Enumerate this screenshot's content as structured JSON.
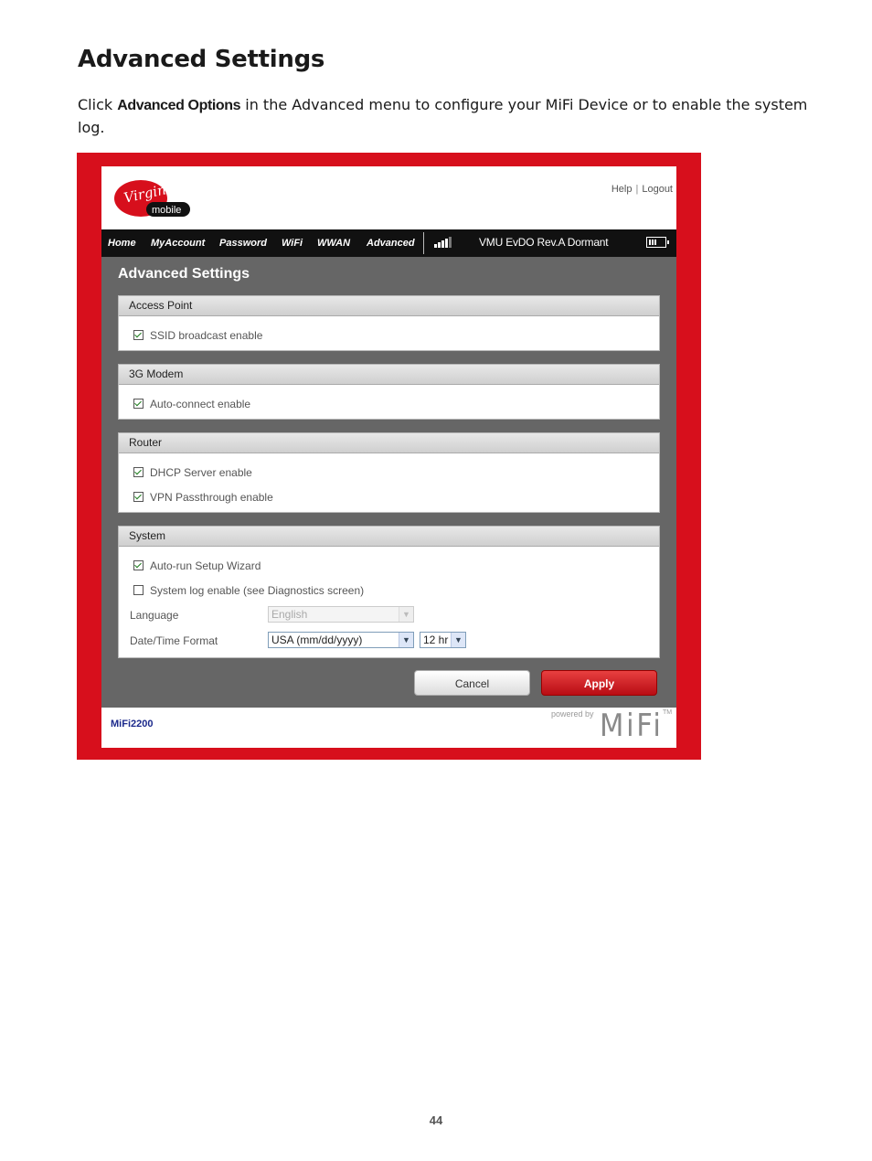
{
  "document": {
    "title": "Advanced Settings",
    "intro_prefix": "Click ",
    "intro_bold": "Advanced Options",
    "intro_suffix": " in the Advanced menu to configure your MiFi Device or to enable the system log.",
    "page_number": "44"
  },
  "ui": {
    "brand_colors": {
      "frame": "#d70f1c",
      "nav_bg": "#111111",
      "content_bg": "#666666",
      "model_text": "#1c2a8c"
    },
    "header": {
      "logo_text_top": "Virgin",
      "logo_text_bottom": "mobile",
      "help": "Help",
      "separator": "|",
      "logout": "Logout"
    },
    "nav": {
      "items": [
        "Home",
        "MyAccount",
        "Password",
        "WiFi",
        "WWAN",
        "Advanced"
      ],
      "signal_icon": "signal-bars-icon",
      "status": "VMU  EvDO Rev.A  Dormant",
      "battery_icon": "battery-icon"
    },
    "page_title": "Advanced Settings",
    "sections": {
      "access_point": {
        "title": "Access Point",
        "ssid_broadcast": "SSID broadcast enable",
        "ssid_broadcast_checked": true
      },
      "modem": {
        "title": "3G Modem",
        "auto_connect": "Auto-connect enable",
        "auto_connect_checked": true
      },
      "router": {
        "title": "Router",
        "dhcp": "DHCP Server enable",
        "dhcp_checked": true,
        "vpn": "VPN Passthrough enable",
        "vpn_checked": true
      },
      "system": {
        "title": "System",
        "auto_run": "Auto-run Setup Wizard",
        "auto_run_checked": true,
        "system_log": "System log enable (see Diagnostics screen)",
        "system_log_checked": false,
        "language_label": "Language",
        "language_value": "English",
        "datetime_label": "Date/Time Format",
        "date_format_value": "USA (mm/dd/yyyy)",
        "time_format_value": "12 hr"
      }
    },
    "buttons": {
      "cancel": "Cancel",
      "apply": "Apply"
    },
    "footer": {
      "model": "MiFi2200",
      "powered_by": "powered by",
      "mifi_logo": "MiFi",
      "tm": "TM"
    }
  }
}
